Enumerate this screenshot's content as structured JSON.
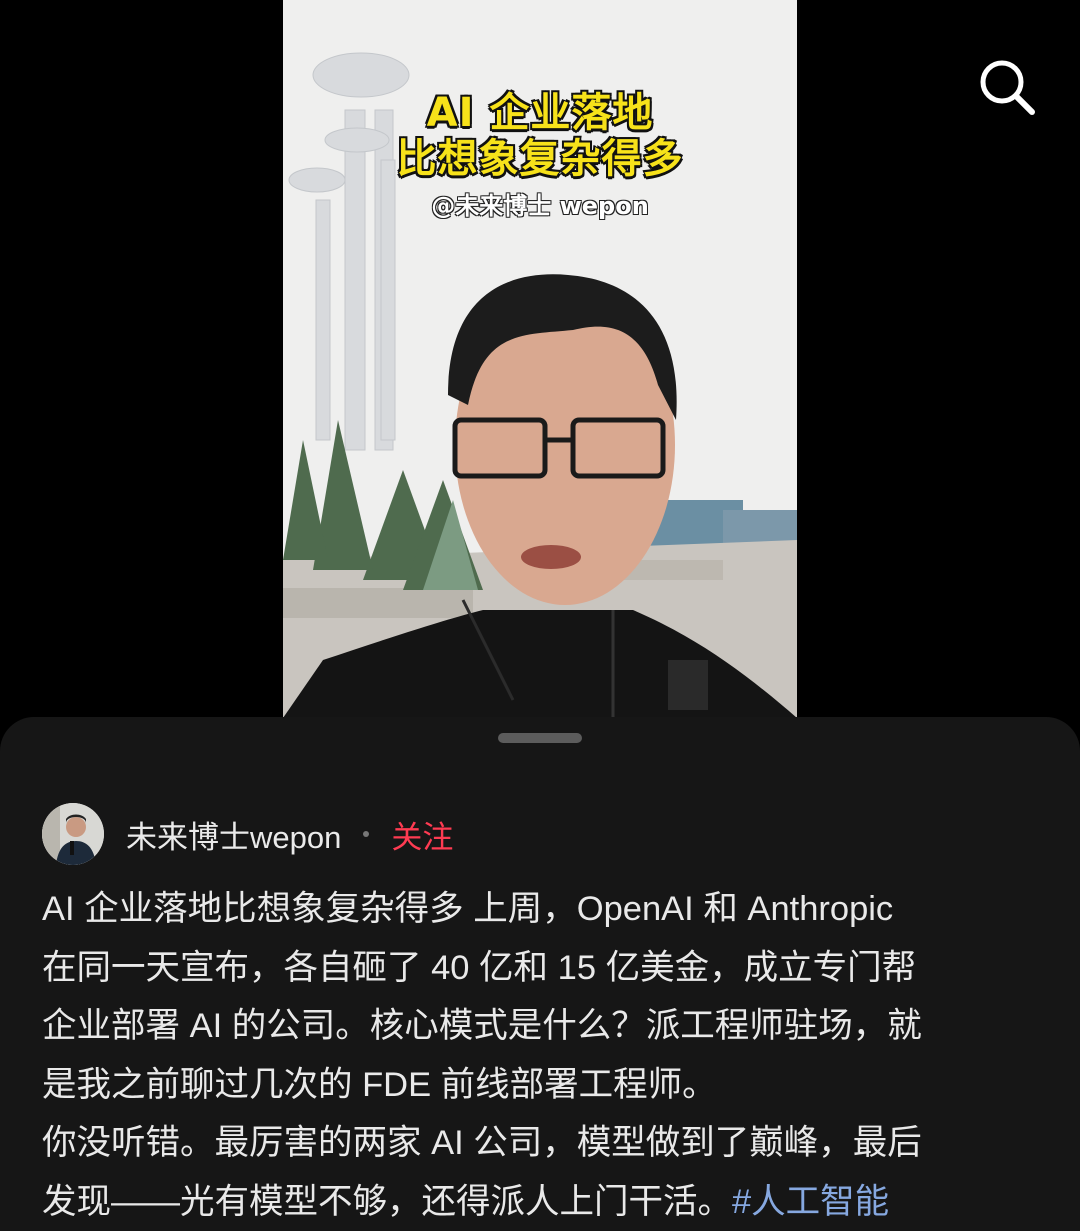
{
  "video": {
    "overlay_title_line1": "AI 企业落地",
    "overlay_title_line2": "比想象复杂得多",
    "overlay_handle": "@未来博士 wepon"
  },
  "toolbar": {
    "search_icon": "search-icon"
  },
  "author": {
    "name": "未来博士wepon",
    "separator": "·",
    "follow_label": "关注"
  },
  "caption": {
    "lines": [
      "AI 企业落地比想象复杂得多 上周，OpenAI 和 Anthropic",
      "在同一天宣布，各自砸了 40 亿和 15 亿美金，成立专门帮",
      "企业部署 AI 的公司。核心模式是什么？派工程师驻场，就",
      "是我之前聊过几次的 FDE 前线部署工程师。",
      "你没听错。最厉害的两家 AI 公司，模型做到了巅峰，最后",
      "发现——光有模型不够，还得派人上门干活。"
    ],
    "hashtag": "#人工智能"
  },
  "colors": {
    "background": "#000000",
    "sheet": "#161616",
    "follow": "#ff3b52",
    "hashtag": "#86a8e0",
    "overlay_title": "#f7e21a"
  }
}
